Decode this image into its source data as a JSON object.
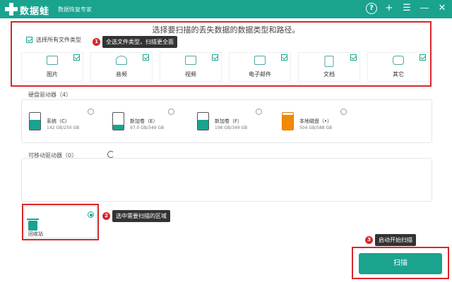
{
  "app": {
    "name": "数据蛙",
    "subtitle": "数据恢复专家",
    "toolbar_icons": [
      "help-icon",
      "plus-icon",
      "menu-icon",
      "minimize-icon",
      "close-icon"
    ]
  },
  "prompt": "选择要扫描的丢失数据的数据类型和路径。",
  "select_all": {
    "label": "选择所有文件类型",
    "checked": true
  },
  "file_types": [
    {
      "label": "图片",
      "icon": "image-icon",
      "checked": true
    },
    {
      "label": "音频",
      "icon": "audio-icon",
      "checked": true
    },
    {
      "label": "视频",
      "icon": "video-icon",
      "checked": true
    },
    {
      "label": "电子邮件",
      "icon": "email-icon",
      "checked": true
    },
    {
      "label": "文档",
      "icon": "document-icon",
      "checked": true
    },
    {
      "label": "其它",
      "icon": "other-icon",
      "checked": true
    }
  ],
  "hard_drives": {
    "title": "硬盘驱动器（4）",
    "drives": [
      {
        "name": "系统（C）",
        "size": "142 GB/250 GB",
        "fill": 0.57,
        "selected": false,
        "color": "#1aa38f"
      },
      {
        "name": "新加卷（E）",
        "size": "97.0 GB/349 GB",
        "fill": 0.28,
        "selected": false,
        "color": "#1aa38f"
      },
      {
        "name": "新加卷（F）",
        "size": "198 GB/349 GB",
        "fill": 0.57,
        "selected": false,
        "color": "#1aa38f"
      },
      {
        "name": "本地磁盘（•）",
        "size": "504 GB/588 GB",
        "fill": 0.86,
        "selected": false,
        "color": "#f08a00"
      }
    ]
  },
  "removable": {
    "title": "可移动驱动器（0）"
  },
  "recycle_bin": {
    "label": "回收站",
    "selected": true
  },
  "callouts": [
    {
      "num": "1",
      "text": "全选文件类型，扫描更全面"
    },
    {
      "num": "2",
      "text": "选中需要扫描的区域"
    },
    {
      "num": "3",
      "text": "启动开始扫描"
    }
  ],
  "scan_button": "扫描",
  "colors": {
    "accent": "#1aa38f",
    "highlight": "#d9262a"
  }
}
